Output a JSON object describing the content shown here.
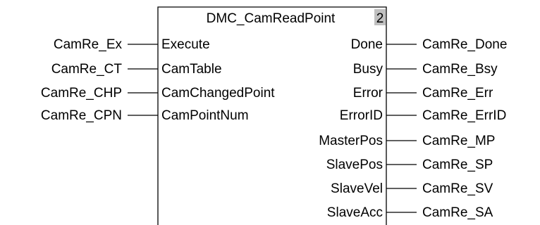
{
  "block": {
    "name": "DMC_CamReadPoint",
    "instance_number": "2",
    "instance_badge_color": "#c0c0c0"
  },
  "inputs": [
    {
      "pin": "Execute",
      "variable": "CamRe_Ex"
    },
    {
      "pin": "CamTable",
      "variable": "CamRe_CT"
    },
    {
      "pin": "CamChangedPoint",
      "variable": "CamRe_CHP"
    },
    {
      "pin": "CamPointNum",
      "variable": "CamRe_CPN"
    }
  ],
  "outputs": [
    {
      "pin": "Done",
      "variable": "CamRe_Done"
    },
    {
      "pin": "Busy",
      "variable": "CamRe_Bsy"
    },
    {
      "pin": "Error",
      "variable": "CamRe_Err"
    },
    {
      "pin": "ErrorID",
      "variable": "CamRe_ErrID"
    },
    {
      "pin": "MasterPos",
      "variable": "CamRe_MP"
    },
    {
      "pin": "SlavePos",
      "variable": "CamRe_SP"
    },
    {
      "pin": "SlaveVel",
      "variable": "CamRe_SV"
    },
    {
      "pin": "SlaveAcc",
      "variable": "CamRe_SA"
    }
  ]
}
